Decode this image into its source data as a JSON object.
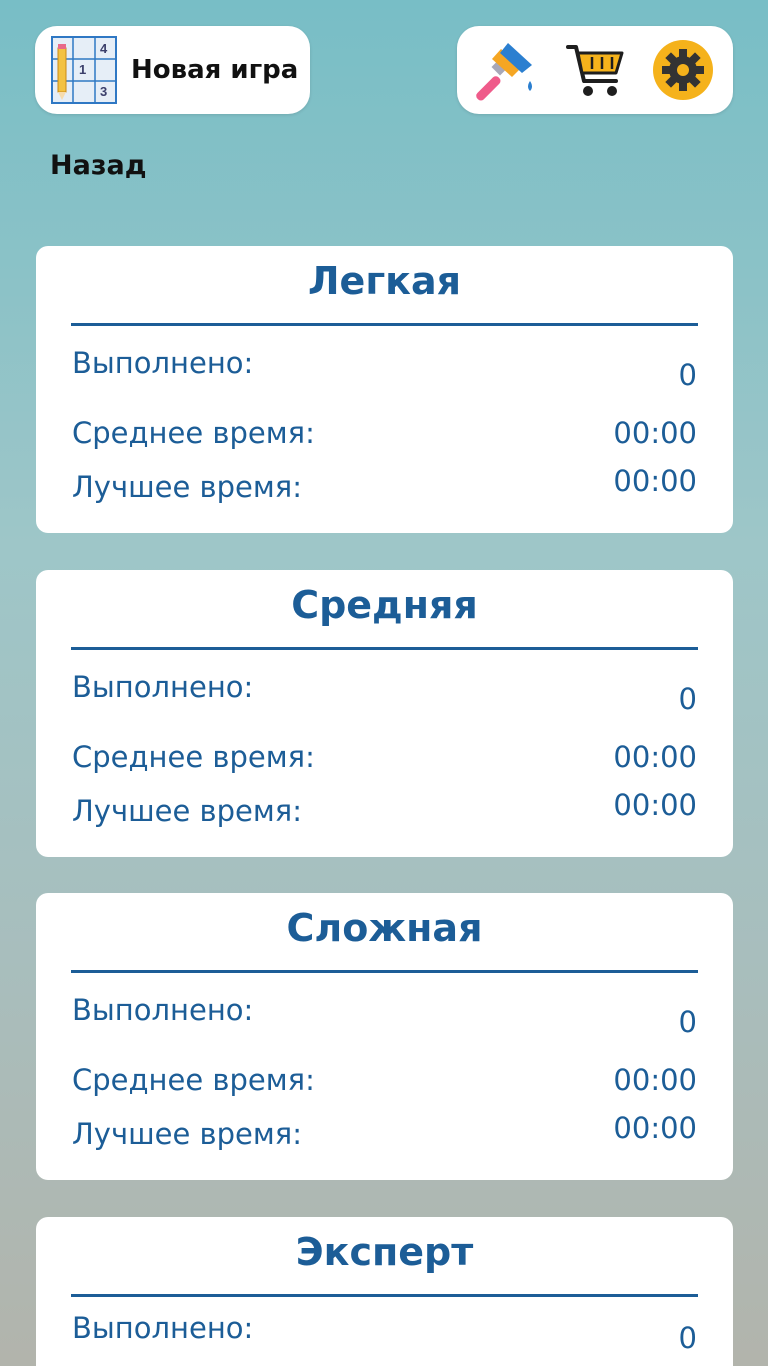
{
  "header": {
    "new_game_label": "Новая игра",
    "sudoku_digits": [
      "4",
      "1",
      "3"
    ],
    "tools": [
      {
        "icon": "paint-brush-icon"
      },
      {
        "icon": "shopping-cart-icon"
      },
      {
        "icon": "gear-icon"
      }
    ]
  },
  "nav": {
    "back_label": "Назад"
  },
  "stat_labels": {
    "completed": "Выполнено:",
    "average_time": "Среднее время:",
    "best_time": "Лучшее время:"
  },
  "levels": [
    {
      "title": "Легкая",
      "completed": "0",
      "average_time": "00:00",
      "best_time": "00:00"
    },
    {
      "title": "Средняя",
      "completed": "0",
      "average_time": "00:00",
      "best_time": "00:00"
    },
    {
      "title": "Сложная",
      "completed": "0",
      "average_time": "00:00",
      "best_time": "00:00"
    },
    {
      "title": "Эксперт",
      "completed": "0"
    }
  ],
  "colors": {
    "accent": "#1c5d97",
    "gear": "#f5b21b",
    "cart": "#1e1e1e"
  }
}
